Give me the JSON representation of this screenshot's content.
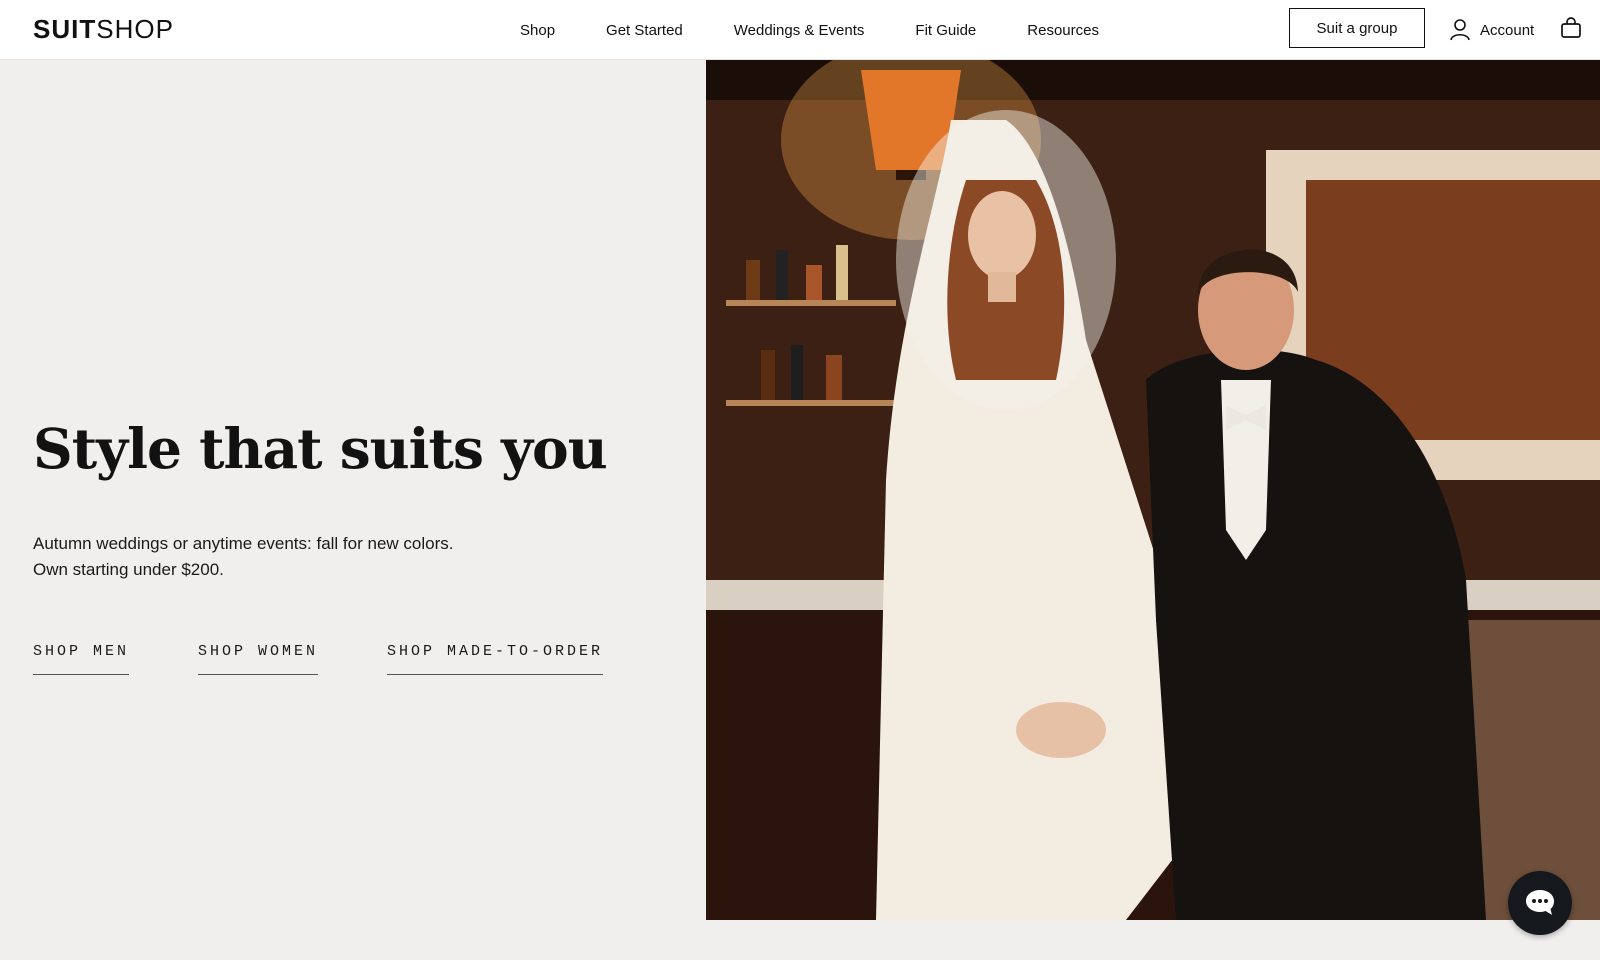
{
  "brand": {
    "logo_bold": "SUIT",
    "logo_light": "SHOP"
  },
  "nav": {
    "items": [
      {
        "label": "Shop"
      },
      {
        "label": "Get Started"
      },
      {
        "label": "Weddings & Events"
      },
      {
        "label": "Fit Guide"
      },
      {
        "label": "Resources"
      }
    ],
    "cta_label": "Suit a group",
    "account_label": "Account"
  },
  "hero": {
    "headline": "Style that suits you",
    "sub_line1": "Autumn weddings or anytime events: fall for new colors.",
    "sub_line2": "Own starting under $200.",
    "ctas": [
      {
        "label": "SHOP MEN"
      },
      {
        "label": "SHOP WOMEN"
      },
      {
        "label": "SHOP MADE-TO-ORDER"
      }
    ]
  },
  "icons": {
    "account": "user-icon",
    "cart": "shopping-bag-icon",
    "chat": "chat-bubble-icon"
  },
  "colors": {
    "background": "#f0efed",
    "text": "#111111",
    "chat_button": "#15181d"
  }
}
